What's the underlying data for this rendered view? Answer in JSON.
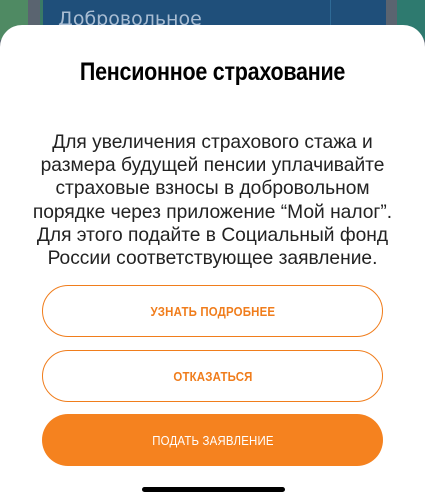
{
  "background": {
    "card_text": "Добровольное"
  },
  "dialog": {
    "title": "Пенсионное страхование",
    "description": "Для увеличения страхового стажа и\nразмера будущей пенсии уплачивайте\nстраховые взносы в добровольном\nпорядке через приложение “Мой налог”.\nДля этого подайте в Социальный фонд\nРоссии соответствующее заявление.",
    "buttons": {
      "learn_more": "УЗНАТЬ ПОДРОБНЕЕ",
      "decline": "ОТКАЗАТЬСЯ",
      "submit": "ПОДАТЬ ЗАЯВЛЕНИЕ"
    }
  },
  "colors": {
    "accent": "#f5821f",
    "sheet": "#ffffff"
  }
}
